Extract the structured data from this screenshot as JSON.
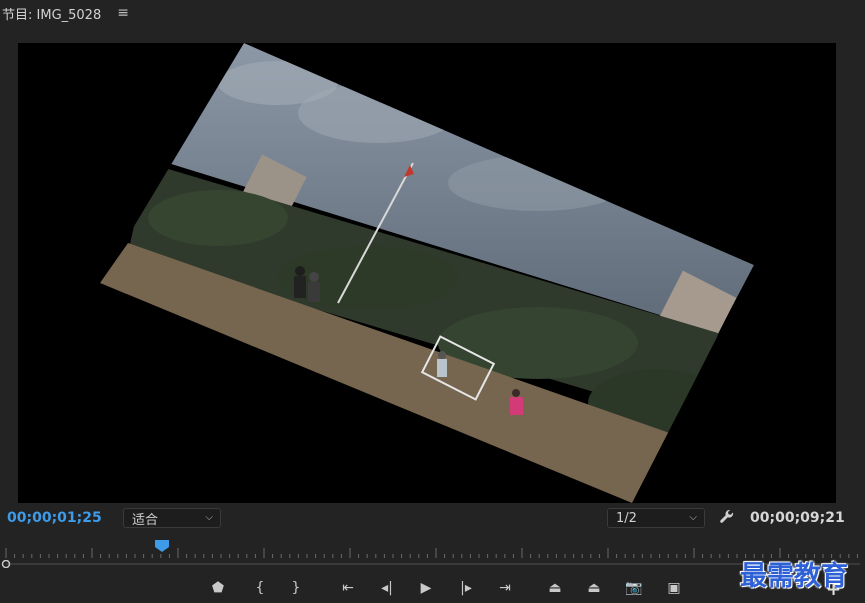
{
  "panel": {
    "title": "节目: IMG_5028",
    "menu_glyph": "≡"
  },
  "monitor": {
    "current_timecode": "00;00;01;25",
    "zoom_value": "适合",
    "resolution_value": "1/2",
    "duration_timecode": "00;00;09;21",
    "settings_icon": "wrench-icon"
  },
  "transport": {
    "buttons": [
      {
        "name": "add-marker-button",
        "glyph": "⬟",
        "icon": "marker-icon"
      },
      {
        "name": "mark-in-button",
        "glyph": "{",
        "icon": "mark-in-icon"
      },
      {
        "name": "mark-out-button",
        "glyph": "}",
        "icon": "mark-out-icon"
      },
      {
        "name": "go-to-in-button",
        "glyph": "⇤",
        "icon": "go-to-in-icon"
      },
      {
        "name": "step-back-button",
        "glyph": "◂|",
        "icon": "step-back-icon"
      },
      {
        "name": "play-button",
        "glyph": "▶",
        "icon": "play-icon"
      },
      {
        "name": "step-forward-button",
        "glyph": "|▸",
        "icon": "step-forward-icon"
      },
      {
        "name": "go-to-out-button",
        "glyph": "⇥",
        "icon": "go-to-out-icon"
      },
      {
        "name": "lift-button",
        "glyph": "⏏",
        "icon": "lift-icon"
      },
      {
        "name": "extract-button",
        "glyph": "⏏",
        "icon": "extract-icon"
      },
      {
        "name": "export-frame-button",
        "glyph": "📷",
        "icon": "camera-icon"
      },
      {
        "name": "compare-button",
        "glyph": "▣",
        "icon": "compare-icon"
      }
    ],
    "add_button_glyph": "+"
  },
  "watermark": {
    "text": "最需教育"
  },
  "colors": {
    "accent": "#3d9be9",
    "panel_bg": "#232323",
    "frame_bg": "#000000"
  }
}
